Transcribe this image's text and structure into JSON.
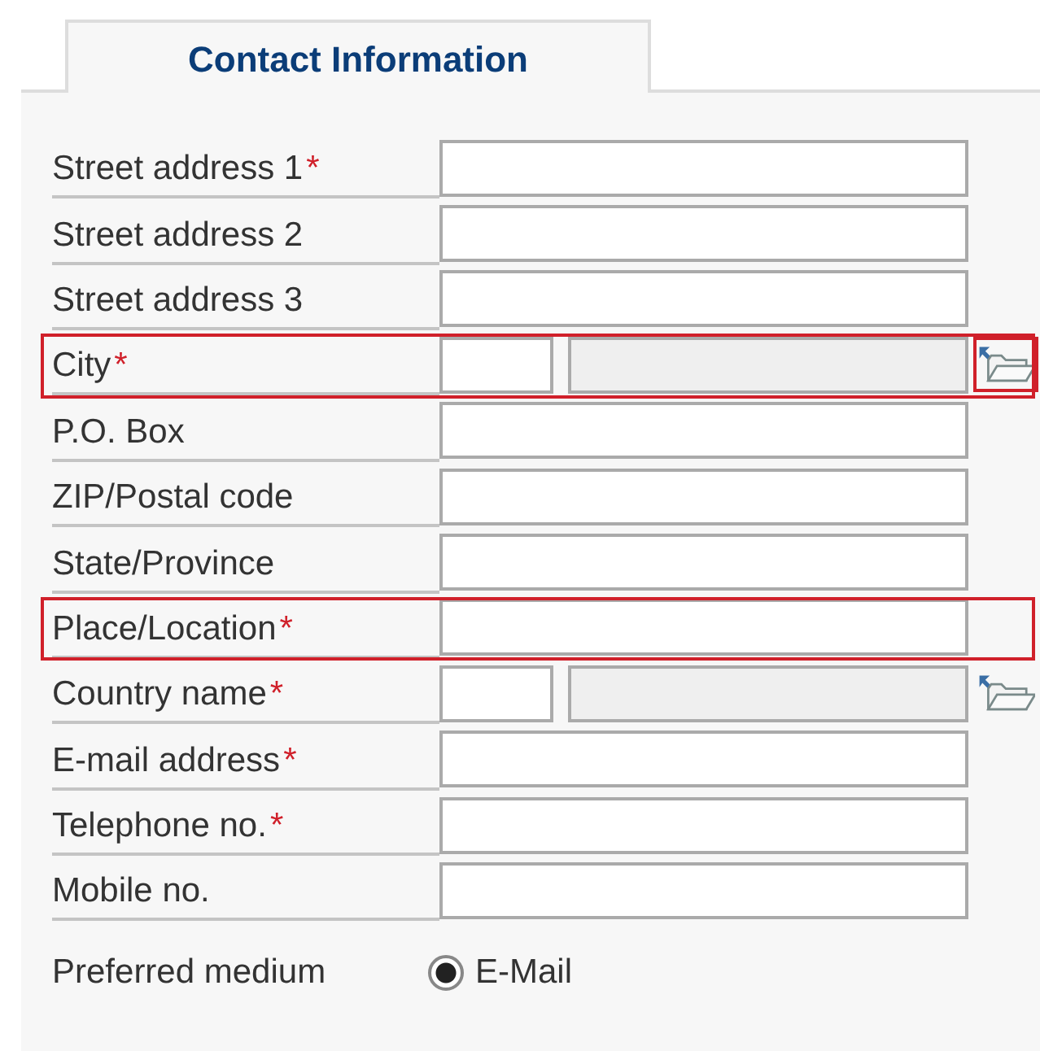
{
  "tabs": [
    {
      "label": "Contact Information",
      "selected": true
    }
  ],
  "fields": [
    {
      "kind": "text",
      "label": "Street address 1",
      "required_mark": "*",
      "highlighted": false
    },
    {
      "kind": "text",
      "label": "Street address 2",
      "highlighted": false
    },
    {
      "kind": "text",
      "label": "Street address 3",
      "highlighted": false
    },
    {
      "kind": "lookup",
      "label": "City",
      "required_mark": "*",
      "highlighted": true,
      "button_highlighted": true
    },
    {
      "kind": "text",
      "label": "P.O. Box",
      "highlighted": false
    },
    {
      "kind": "text",
      "label": "ZIP/Postal code",
      "highlighted": false
    },
    {
      "kind": "text",
      "label": "State/Province",
      "highlighted": false
    },
    {
      "kind": "text",
      "label": "Place/Location",
      "required_mark": "*",
      "highlighted": true
    },
    {
      "kind": "lookup",
      "label": "Country name",
      "required_mark": "*",
      "highlighted": false,
      "button_highlighted": false
    },
    {
      "kind": "text",
      "label": "E-mail address",
      "required_mark": "*",
      "highlighted": false
    },
    {
      "kind": "text",
      "label": "Telephone no.",
      "required_mark": "*",
      "highlighted": false
    },
    {
      "kind": "text",
      "label": "Mobile no.",
      "highlighted": false
    }
  ],
  "preferred_medium": {
    "label": "Preferred medium",
    "options": [
      {
        "label": "E-Mail",
        "selected": true
      }
    ]
  }
}
